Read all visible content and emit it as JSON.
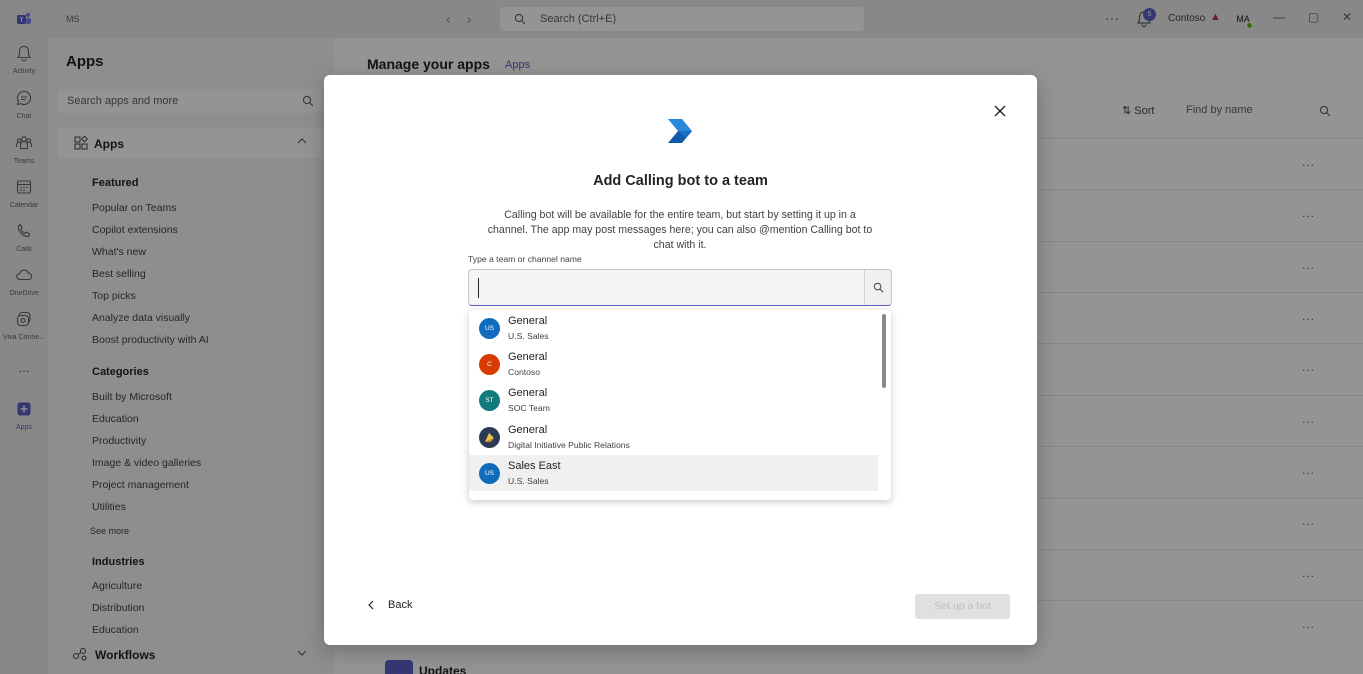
{
  "topbar": {
    "org_short": "MS",
    "search_placeholder": "Search (Ctrl+E)",
    "notification_count": "5",
    "org_name": "Contoso",
    "avatar_initials": "MA",
    "icons": [
      "teams-logo-icon",
      "back-arrow-icon",
      "forward-arrow-icon",
      "search-icon",
      "more-icon",
      "bell-icon",
      "warning-icon",
      "minimize-icon",
      "maximize-icon",
      "close-icon"
    ]
  },
  "rail": {
    "items": [
      {
        "label": "Activity",
        "icon": "bell-icon"
      },
      {
        "label": "Chat",
        "icon": "chat-icon"
      },
      {
        "label": "Teams",
        "icon": "teams-icon"
      },
      {
        "label": "Calendar",
        "icon": "calendar-icon"
      },
      {
        "label": "Calls",
        "icon": "phone-icon"
      },
      {
        "label": "OneDrive",
        "icon": "cloud-icon"
      },
      {
        "label": "Viva Conne...",
        "icon": "viva-icon"
      },
      {
        "label": "Apps",
        "icon": "plus-icon"
      }
    ],
    "more": "..."
  },
  "apps_panel": {
    "title": "Apps",
    "search_placeholder": "Search apps and more",
    "section_label": "Apps",
    "featured_heading": "Featured",
    "featured": [
      "Popular on Teams",
      "Copilot extensions",
      "What's new",
      "Best selling",
      "Top picks",
      "Analyze data visually",
      "Boost productivity with AI"
    ],
    "categories_heading": "Categories",
    "categories": [
      "Built by Microsoft",
      "Education",
      "Productivity",
      "Image & video galleries",
      "Project management",
      "Utilities"
    ],
    "see_more": "See more",
    "industries_heading": "Industries",
    "industries": [
      "Agriculture",
      "Distribution",
      "Education"
    ],
    "workflows_label": "Workflows"
  },
  "main": {
    "title": "Manage your apps",
    "crumb": "Apps",
    "sort_label": "Sort",
    "find_placeholder": "Find by name",
    "row_more": "...",
    "updates_label": "Updates"
  },
  "dialog": {
    "title": "Add Calling bot to a team",
    "description": "Calling bot will be available for the entire team, but start by setting it up in a channel. The app may post messages here; you can also @mention Calling bot to chat with it.",
    "input_label": "Type a team or channel name",
    "input_value": "",
    "options": [
      {
        "name": "General",
        "team": "U.S. Sales",
        "initials": "US",
        "color": "#0f6cbd"
      },
      {
        "name": "General",
        "team": "Contoso",
        "initials": "C",
        "color": "#d83b01"
      },
      {
        "name": "General",
        "team": "SOC Team",
        "initials": "ST",
        "color": "#0f7b7d"
      },
      {
        "name": "General",
        "team": "Digital Initiative Public Relations",
        "initials": "",
        "color": "#2b3a55"
      },
      {
        "name": "Sales East",
        "team": "U.S. Sales",
        "initials": "US",
        "color": "#0f6cbd"
      }
    ],
    "back_label": "Back",
    "setup_label": "Set up a bot"
  }
}
